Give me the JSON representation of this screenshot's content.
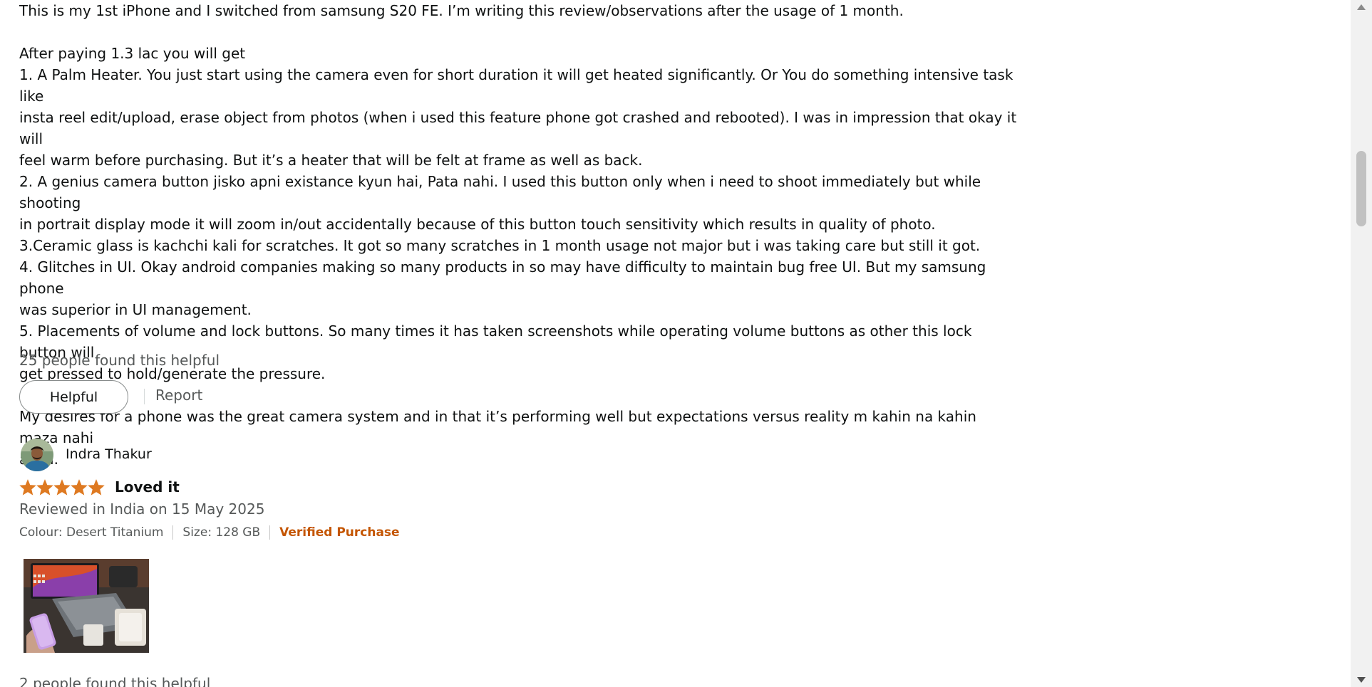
{
  "review1": {
    "paragraphs": [
      "This is my 1st iPhone and I switched from samsung S20 FE. I’m writing this review/observations after the usage of 1 month.",
      "",
      "After paying 1.3 lac you will get",
      "1. A Palm Heater. You just start using the camera even for short duration it will get heated significantly. Or You do something intensive task like",
      "insta reel edit/upload, erase object from photos (when i used this feature phone got crashed and rebooted). I was in impression that okay it will",
      "feel warm before purchasing. But it’s a heater that will be felt at frame as well as back.",
      "2. A genius camera button jisko apni existance kyun hai, Pata nahi. I used this button only when i need to shoot immediately but while shooting",
      "in portrait display mode it will zoom in/out accidentally because of this button touch sensitivity which results in quality of photo.",
      "3.Ceramic glass is kachchi kali for scratches. It got so many scratches in 1 month usage not major but i was taking care but still it got.",
      "4. Glitches in UI. Okay android companies making so many products in so may have difficulty to maintain bug free UI. But my samsung phone",
      "was superior in UI management.",
      "5. Placements of volume and lock buttons. So many times it has taken screenshots while operating volume buttons as other this lock button will",
      "get pressed to hold/generate the pressure.",
      "",
      "My desires for a phone was the great camera system and in that it’s performing well but expectations versus reality m kahin na kahin maza nahi",
      "aaya."
    ],
    "helpful_count": "25 people found this helpful",
    "helpful_button": "Helpful",
    "report_link": "Report"
  },
  "review2": {
    "reviewer_name": "Indra Thakur",
    "rating": 5,
    "rating_max": 5,
    "star_color": "#de7921",
    "title": "Loved it",
    "date": "Reviewed in India on 15 May 2025",
    "colour": "Colour: Desert Titanium",
    "size": "Size: 128 GB",
    "verified": "Verified Purchase",
    "helpful_count": "2 people found this helpful"
  },
  "colors": {
    "text": "#0f1111",
    "secondary_text": "#565959",
    "verified": "#c45500",
    "star": "#de7921"
  }
}
